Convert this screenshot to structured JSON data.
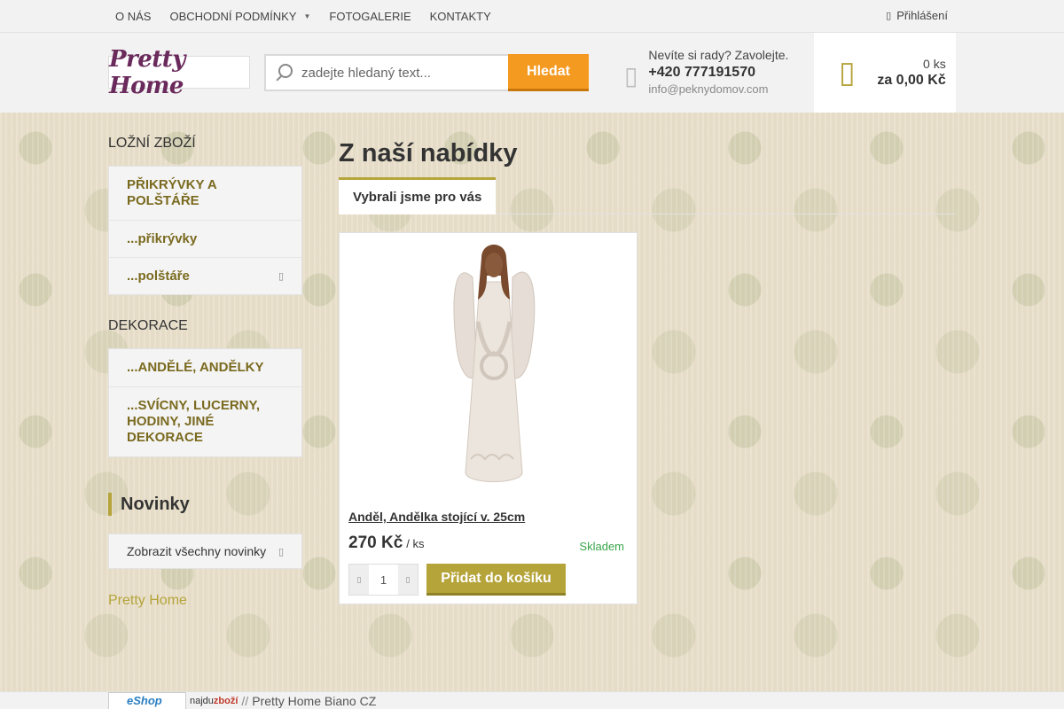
{
  "topnav": {
    "items": [
      {
        "label": "O NÁS",
        "has_dropdown": false
      },
      {
        "label": "OBCHODNÍ PODMÍNKY",
        "has_dropdown": true
      },
      {
        "label": "FOTOGALERIE",
        "has_dropdown": false
      },
      {
        "label": "KONTAKTY",
        "has_dropdown": false
      }
    ],
    "login_label": "Přihlášení"
  },
  "header": {
    "logo_text": "Pretty Home",
    "search": {
      "placeholder": "zadejte hledaný text...",
      "button_label": "Hledat"
    },
    "contact": {
      "question": "Nevíte si rady? Zavolejte.",
      "phone": "+420 777191570",
      "email": "info@peknydomov.com"
    },
    "cart": {
      "count": "0 ks",
      "total": "za 0,00 Kč"
    }
  },
  "sidebar": {
    "section1": {
      "title": "LOŽNÍ ZBOŽÍ",
      "items": [
        "PŘIKRÝVKY A POLŠTÁŘE",
        "...přikrývky",
        "...polštáře"
      ]
    },
    "section2": {
      "title": "DEKORACE",
      "items": [
        "...ANDĚLÉ, ANDĚLKY",
        "...SVÍCNY, LUCERNY, HODINY, JINÉ DEKORACE"
      ]
    },
    "news": {
      "title": "Novinky",
      "link_label": "Zobrazit všechny novinky"
    },
    "brand": "Pretty Home"
  },
  "main": {
    "title": "Z naší nabídky",
    "tab_label": "Vybrali jsme pro vás",
    "product": {
      "name": "Anděl, Andělka stojící v. 25cm",
      "price": "270 Kč",
      "unit": "/ ks",
      "stock": "Skladem",
      "quantity": "1",
      "add_label": "Přidat do košíku"
    }
  },
  "footer": {
    "eshop_badge": "eShop",
    "najdu_prefix": "najdu",
    "najdu_bold": "zboží",
    "separator": "//",
    "biano": "Pretty Home Biano CZ"
  },
  "colors": {
    "accent": "#b5a43a",
    "search_button": "#f49a21",
    "stock": "#3aa54a"
  }
}
